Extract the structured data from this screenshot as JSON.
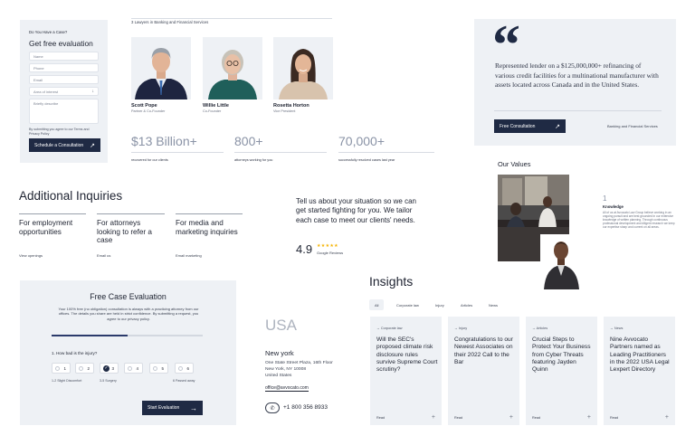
{
  "contact_form": {
    "eyebrow": "Do You Have a Case?",
    "title": "Get free evaluation",
    "name_placeholder": "Name",
    "phone_placeholder": "Phone",
    "email_placeholder": "Email",
    "area_placeholder": "Area of interest",
    "describe_placeholder": "Briefly describe",
    "consent_text": "By submitting you agree to our Terms and Privacy Policy",
    "submit_label": "Schedule a Consultation"
  },
  "team": {
    "heading": "3 Lawyers in Banking and Financial Services",
    "members": [
      {
        "name": "Scott Pope",
        "role": "Partner & Co-Founder"
      },
      {
        "name": "Willie Little",
        "role": "Co-Founder"
      },
      {
        "name": "Rosetta Horton",
        "role": "Vice President"
      }
    ]
  },
  "stats": [
    {
      "value": "$13 Billion+",
      "label": "recovered for our clients"
    },
    {
      "value": "800+",
      "label": "attorneys working for you"
    },
    {
      "value": "70,000+",
      "label": "successfully resolved cases last year"
    }
  ],
  "quote": {
    "mark": "“",
    "text": "Represented lender on a $125,000,000+ refinancing of various credit facilities for a multinational manufacturer with assets located across Canada and in the United States.",
    "button_label": "Free Consultation",
    "category": "Banking and Financial Services"
  },
  "values": {
    "title": "Our Values",
    "number": "1",
    "item_title": "Knowledge",
    "item_text": "All of us at Avvocato Law Group believe working in an ongoing pursuit and are best grounded in our extensive knowledge of written planning. Through continuous professional development and diligent research we keep our expertise sharp and current on all areas."
  },
  "inquiries": {
    "title": "Additional Inquiries",
    "items": [
      {
        "title": "For employment opportunities",
        "link": "View openings"
      },
      {
        "title": "For attorneys looking to refer a case",
        "link": "Email us"
      },
      {
        "title": "For media and marketing inquiries",
        "link": "Email marketing"
      }
    ]
  },
  "situation": {
    "text": "Tell us about your situation so we can get started fighting for you. We tailor each case to meet our clients' needs.",
    "rating": "4.9",
    "stars": "★★★★★",
    "reviews_label": "Google Reviews",
    "star_color": "#f5b301"
  },
  "free_case": {
    "title": "Free Case Evaluation",
    "description": "Your 100% free (no obligation) consultation is always with a practicing attorney from our offices. The details you share are held in strict confidence. By submitting a request, you agree to our privacy policy.",
    "progress": 0.5,
    "question": "1. How bad is the injury?",
    "options": [
      "1",
      "2",
      "3",
      "4",
      "5",
      "6"
    ],
    "selected": "3",
    "scale_labels": [
      "1-2 Slight Discomfort",
      "3-5 Surgery",
      "6 Passed away"
    ],
    "submit_label": "Start Evaluation"
  },
  "office": {
    "country": "USA",
    "city": "New york",
    "address_line1": "One State Street Plaza, 16th Floor",
    "address_line2": "New York, NY 10008",
    "address_line3": "United States",
    "email": "office@avvocato.com",
    "phone": "+1 800 356 8933"
  },
  "insights": {
    "title": "Insights",
    "tabs": [
      "All",
      "Corporate law",
      "Injury",
      "Articles",
      "News"
    ],
    "active_tab": "All",
    "cards": [
      {
        "category": "Corporate law",
        "title": "Will the SEC's proposed climate risk disclosure rules survive Supreme Court scrutiny?",
        "read": "Read"
      },
      {
        "category": "Injury",
        "title": "Congratulations to our Newest Associates on their 2022 Call to the Bar",
        "read": "Read"
      },
      {
        "category": "Articles",
        "title": "Crucial Steps to Protect Your Business from Cyber Threats featuring Jayden Quinn",
        "read": "Read"
      },
      {
        "category": "News",
        "title": "Nine Avvocato Partners named as Leading Practitioners in the 2022 USA Legal Lexpert Directory",
        "read": "Read"
      }
    ]
  },
  "colors": {
    "navy": "#1f2a44",
    "panel": "#eef1f5",
    "muted": "#8a93a6"
  }
}
